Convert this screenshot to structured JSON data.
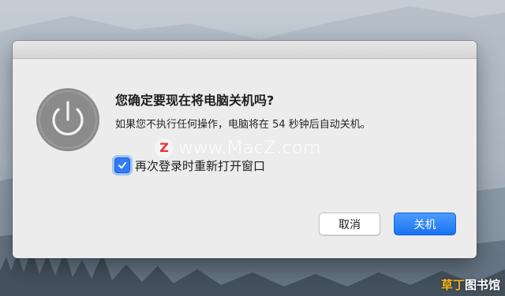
{
  "dialog": {
    "title": "您确定要现在将电脑关机吗?",
    "message": "如果您不执行任何操作，电脑将在 54 秒钟后自动关机。",
    "reopen_checkbox": {
      "label": "再次登录时重新打开窗口",
      "checked": true
    },
    "buttons": {
      "cancel": "取消",
      "shutdown": "关机"
    },
    "icon": "power-icon"
  },
  "watermark": {
    "logo_letter": "Z",
    "text": "www.MacZ.com"
  },
  "corner_badge": {
    "accent": "草丁",
    "text": "图书馆"
  },
  "colors": {
    "accent": "#1a73f0",
    "dialog_bg": "#ececec",
    "icon_bg": "#8b8b8b"
  }
}
